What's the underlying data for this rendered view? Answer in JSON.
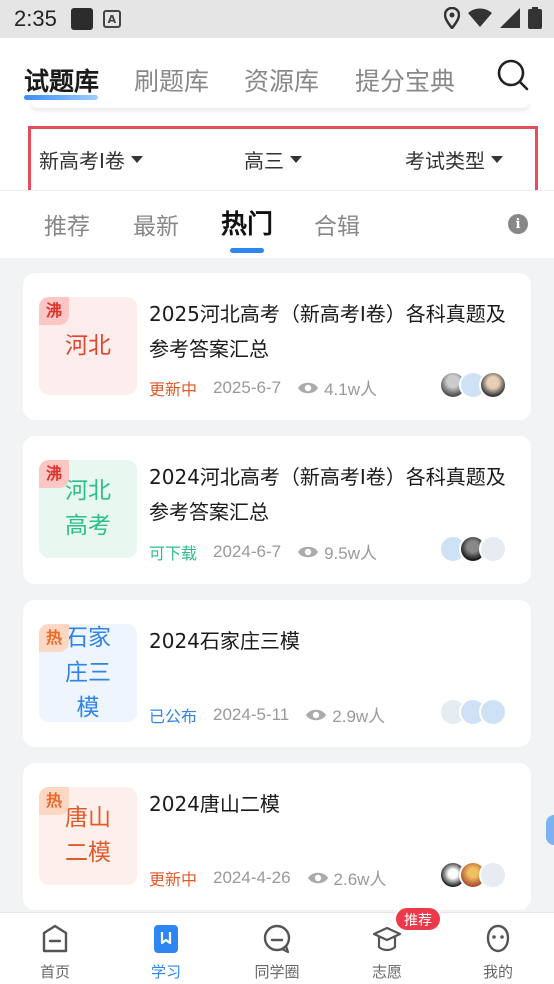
{
  "status_bar": {
    "time": "2:35"
  },
  "main_tabs": [
    {
      "label": "试题库",
      "active": true
    },
    {
      "label": "刷题库",
      "active": false
    },
    {
      "label": "资源库",
      "active": false
    },
    {
      "label": "提分宝典",
      "active": false
    }
  ],
  "filters": {
    "paper": "新高考I卷",
    "grade": "高三",
    "exam_type": "考试类型"
  },
  "sub_tabs": [
    {
      "label": "推荐",
      "active": false
    },
    {
      "label": "最新",
      "active": false
    },
    {
      "label": "热门",
      "active": true
    },
    {
      "label": "合辑",
      "active": false
    }
  ],
  "cards": [
    {
      "tag": "沸",
      "thumb": "河北",
      "title": "2025河北高考（新高考I卷）各科真题及参考答案汇总",
      "status": "更新中",
      "date": "2025-6-7",
      "views": "4.1w人"
    },
    {
      "tag": "沸",
      "thumb": "河北高考",
      "title": "2024河北高考（新高考I卷）各科真题及参考答案汇总",
      "status": "可下载",
      "date": "2024-6-7",
      "views": "9.5w人"
    },
    {
      "tag": "热",
      "thumb": "石家庄三模",
      "title": "2024石家庄三模",
      "status": "已公布",
      "date": "2024-5-11",
      "views": "2.9w人"
    },
    {
      "tag": "热",
      "thumb": "唐山二模",
      "title": "2024唐山二模",
      "status": "更新中",
      "date": "2024-4-26",
      "views": "2.6w人"
    }
  ],
  "bottom_nav": [
    {
      "label": "首页",
      "icon": "home-icon"
    },
    {
      "label": "学习",
      "icon": "study-book-icon",
      "active": true
    },
    {
      "label": "同学圈",
      "icon": "classmates-chat-icon"
    },
    {
      "label": "志愿",
      "icon": "graduation-cap-icon"
    },
    {
      "label": "我的",
      "icon": "profile-face-icon"
    }
  ],
  "badge": "推荐",
  "colors": {
    "accent": "#2e86f2",
    "highlight_border": "#e64d5a",
    "status_orange": "#e05a2a",
    "status_green": "#2cbf88",
    "status_blue": "#2f84e6",
    "badge_red": "#ec3a4a"
  }
}
